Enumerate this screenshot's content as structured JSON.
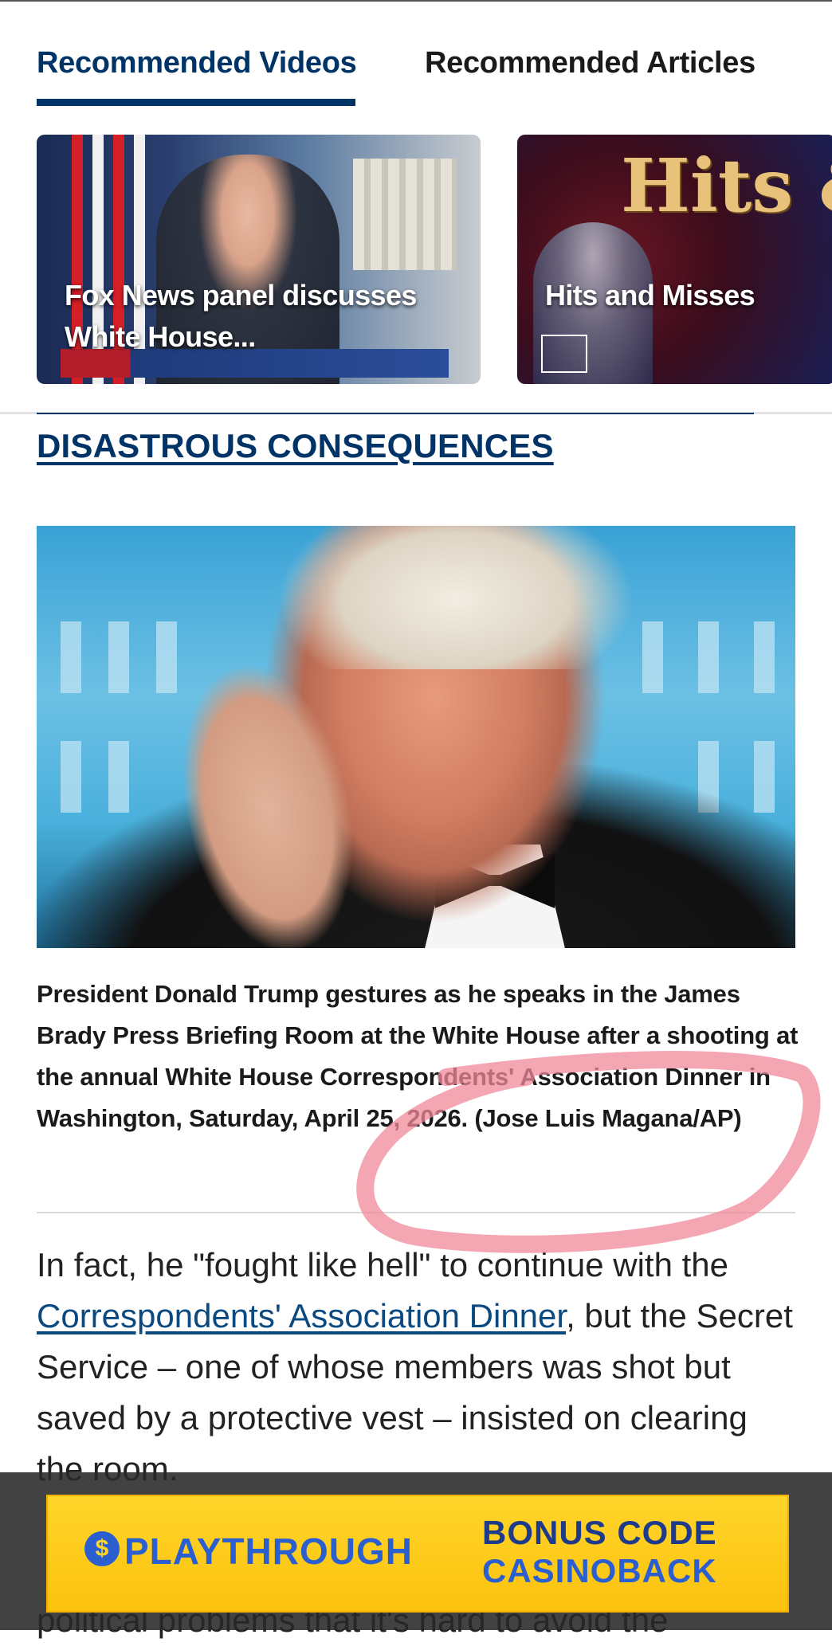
{
  "tabs": {
    "videos": "Recommended Videos",
    "articles": "Recommended Articles"
  },
  "videos": [
    {
      "title": "Fox News panel discusses White House..."
    },
    {
      "title": "Hits and Misses",
      "graphic_text": "Hits & Misses"
    }
  ],
  "headline": "DISASTROUS CONSEQUENCES",
  "photo": {
    "caption": "President Donald Trump gestures as he speaks in the James Brady Press Briefing Room at the White House after a shooting at the annual White House Correspondents' Association Dinner in Washington, Saturday, April 25, 2026. (Jose Luis Magana/AP)"
  },
  "body": {
    "p1_before": "In fact, he \"fought like hell\" to continue with the ",
    "p1_link": "Correspondents' Association Dinner",
    "p1_after": ", but the Secret Service – one of whose members was shot but saved by a protective vest – insisted on clearing the room.",
    "p2_fragment": "political problems that it's hard to avoid the"
  },
  "ad": {
    "brand": "PLAYTHROUGH",
    "code_line1": "BONUS CODE",
    "code_line2": "CASINOBACK"
  },
  "colors": {
    "brand_navy": "#003366",
    "annotation_pink": "#f08a9a",
    "ad_yellow": "#fcc20e",
    "ad_blue": "#2b5fd0"
  }
}
